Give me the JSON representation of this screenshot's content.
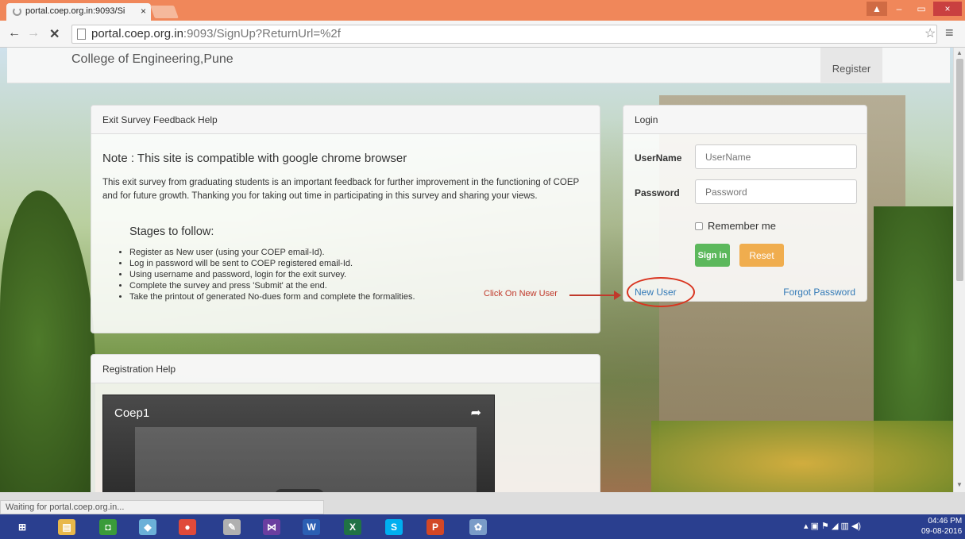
{
  "browser": {
    "tab_title": "portal.coep.org.in:9093/Si",
    "tab_close": "×",
    "url_host": "portal.coep.org.in",
    "url_rest": ":9093/SignUp?ReturnUrl=%2f",
    "back": "←",
    "forward": "→",
    "stop": "✕",
    "star": "☆",
    "menu": "≡"
  },
  "window_controls": {
    "user": "▲",
    "minimize": "–",
    "maximize": "▭",
    "close": "×"
  },
  "navbar": {
    "brand": "College of Engineering,Pune",
    "register": "Register"
  },
  "exit_panel": {
    "heading": "Exit Survey Feedback Help",
    "note": "Note : This site is compatible with google chrome browser",
    "intro": "This exit survey from graduating students is an important feedback for further improvement in the functioning of COEP and for future growth. Thanking you for taking out time in participating in this survey and sharing your views.",
    "stages_title": "Stages to follow:",
    "stages": [
      "Register as New user (using your COEP email-Id).",
      "Log in password will be sent to COEP registered email-Id.",
      "Using username and password, login for the exit survey.",
      "Complete the survey and press 'Submit' at the end.",
      "Take the printout of generated No-dues form and complete the formalities."
    ],
    "callout": "Click On New User"
  },
  "login_panel": {
    "heading": "Login",
    "username_label": "UserName",
    "username_placeholder": "UserName",
    "password_label": "Password",
    "password_placeholder": "Password",
    "remember": "Remember me",
    "signin": "Sign in",
    "reset": "Reset",
    "new_user": "New User",
    "forgot": "Forgot Password"
  },
  "registration_panel": {
    "heading": "Registration Help",
    "video_title": "Coep1"
  },
  "status": "Waiting for portal.coep.org.in...",
  "taskbar": {
    "items": [
      {
        "name": "start",
        "glyph": "⊞",
        "color": "#2a3f8f"
      },
      {
        "name": "file-explorer",
        "glyph": "▤",
        "color": "#e8b84a"
      },
      {
        "name": "store",
        "glyph": "◘",
        "color": "#3a9b3a"
      },
      {
        "name": "photos",
        "glyph": "◆",
        "color": "#6bb0d8"
      },
      {
        "name": "chrome",
        "glyph": "●",
        "color": "#e04a3a"
      },
      {
        "name": "tool",
        "glyph": "✎",
        "color": "#b0b0b0"
      },
      {
        "name": "visual-studio",
        "glyph": "⋈",
        "color": "#6a3ea0"
      },
      {
        "name": "word",
        "glyph": "W",
        "color": "#2b5fb3"
      },
      {
        "name": "excel",
        "glyph": "X",
        "color": "#207245"
      },
      {
        "name": "skype",
        "glyph": "S",
        "color": "#00aff0"
      },
      {
        "name": "powerpoint",
        "glyph": "P",
        "color": "#d24726"
      },
      {
        "name": "paint",
        "glyph": "✿",
        "color": "#7a9cc8"
      }
    ],
    "tray": "▴ ▣ ⚑ ◢ ▥ ◀)",
    "time": "04:46 PM",
    "date": "09-08-2016"
  }
}
